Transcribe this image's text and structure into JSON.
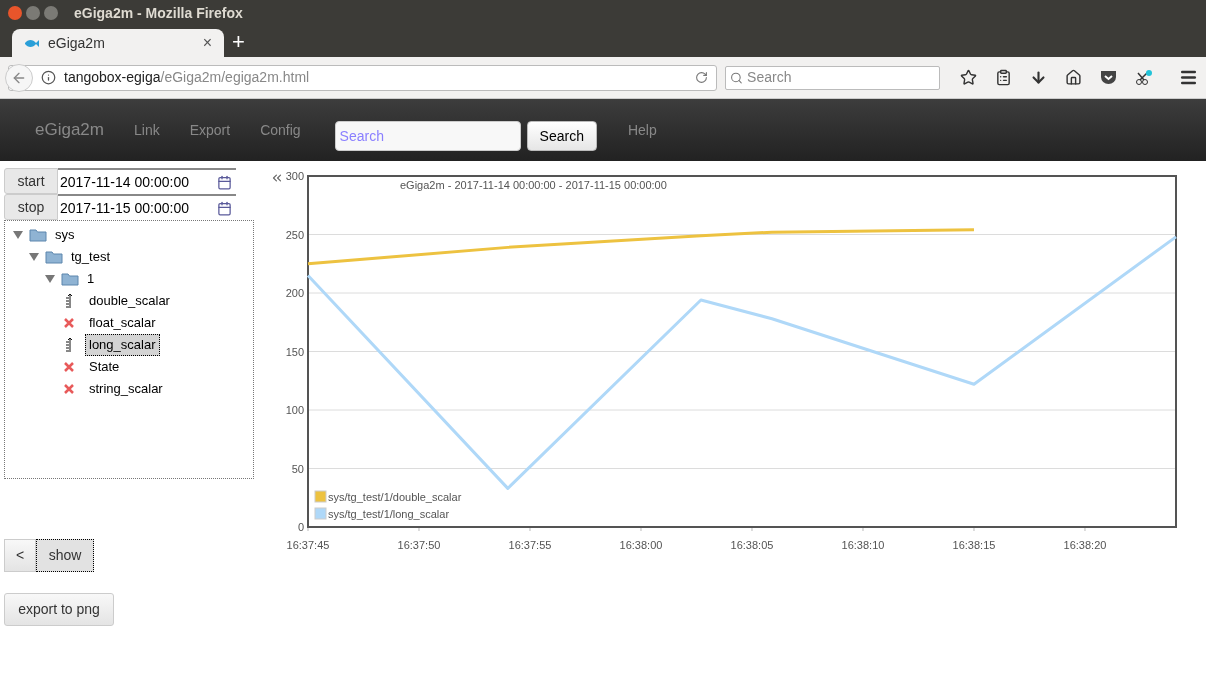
{
  "window": {
    "title": "eGiga2m - Mozilla Firefox"
  },
  "tabs": [
    {
      "label": "eGiga2m",
      "selected": true,
      "close": "×"
    }
  ],
  "new_tab": "+",
  "address": {
    "host": "tangobox-egiga",
    "path": "/eGiga2m/egiga2m.html"
  },
  "browser_search": {
    "placeholder": "Search"
  },
  "navbar": {
    "brand": "eGiga2m",
    "links": [
      "Link",
      "Export",
      "Config"
    ],
    "search": {
      "placeholder": "Search"
    },
    "search_button": "Search",
    "help": "Help"
  },
  "start": {
    "label": "start",
    "value": "2017-11-14 00:00:00"
  },
  "stop": {
    "label": "stop",
    "value": "2017-11-15 00:00:00"
  },
  "tree": [
    {
      "label": "sys",
      "kind": "folder",
      "expanded": true,
      "children": [
        {
          "label": "tg_test",
          "kind": "folder",
          "expanded": true,
          "children": [
            {
              "label": "1",
              "kind": "folder",
              "expanded": true,
              "children": [
                {
                  "label": "double_scalar",
                  "kind": "plotted",
                  "selected": false
                },
                {
                  "label": "float_scalar",
                  "kind": "unavailable",
                  "selected": false
                },
                {
                  "label": "long_scalar",
                  "kind": "plotted",
                  "selected": true
                },
                {
                  "label": "State",
                  "kind": "unavailable",
                  "selected": false
                },
                {
                  "label": "string_scalar",
                  "kind": "unavailable",
                  "selected": false
                }
              ]
            }
          ]
        }
      ]
    }
  ],
  "collapse_button": "<",
  "show_button": "show",
  "export_button": "export to png",
  "chart": {
    "chart_data": {
      "type": "line",
      "title": "eGiga2m - 2017-11-14 00:00:00 - 2017-11-15 00:00:00",
      "x": [
        59865,
        59874,
        59882.7,
        59885.9,
        59895,
        59904.1
      ],
      "series": [
        {
          "name": "sys/tg_test/1/double_scalar",
          "color": "#edc240",
          "values": [
            225,
            239,
            249,
            252,
            254,
            null
          ]
        },
        {
          "name": "sys/tg_test/1/long_scalar",
          "color": "#afd8f8",
          "values": [
            215,
            33,
            194,
            178,
            122,
            248
          ]
        }
      ],
      "grid": true,
      "legend": true,
      "xlim": [
        59865,
        59904.1
      ],
      "ylim": [
        0,
        300
      ],
      "xticks": [
        {
          "value": 59865,
          "label": "16:37:45"
        },
        {
          "value": 59870,
          "label": "16:37:50"
        },
        {
          "value": 59875,
          "label": "16:37:55"
        },
        {
          "value": 59880,
          "label": "16:38:00"
        },
        {
          "value": 59885,
          "label": "16:38:05"
        },
        {
          "value": 59890,
          "label": "16:38:10"
        },
        {
          "value": 59895,
          "label": "16:38:15"
        },
        {
          "value": 59900,
          "label": "16:38:20"
        }
      ],
      "yticks": [
        0,
        50,
        100,
        150,
        200,
        250,
        300
      ]
    }
  }
}
